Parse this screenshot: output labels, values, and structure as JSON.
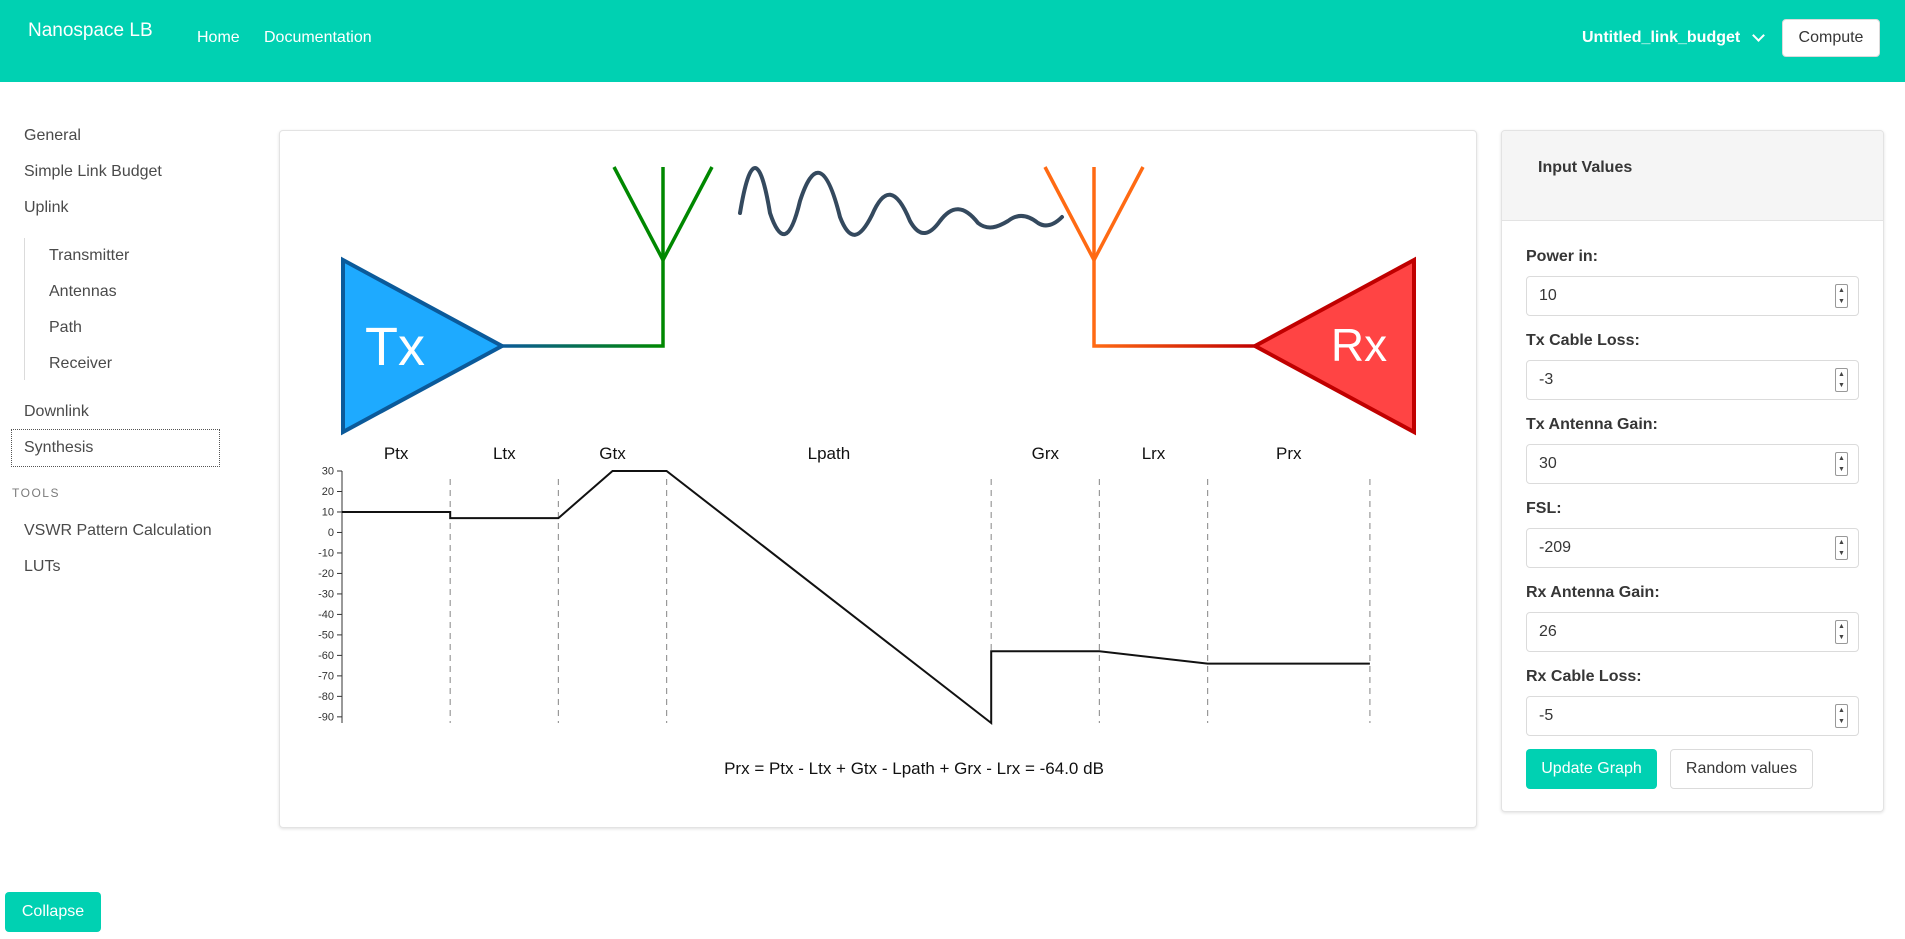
{
  "navbar": {
    "brand": "Nanospace LB",
    "links": [
      "Home",
      "Documentation"
    ],
    "project_name": "Untitled_link_budget",
    "compute_label": "Compute",
    "color": "#00d1b2"
  },
  "sidebar": {
    "items": [
      "General",
      "Simple Link Budget",
      "Uplink"
    ],
    "uplink_items": [
      "Transmitter",
      "Antennas",
      "Path",
      "Receiver"
    ],
    "after_items": [
      "Downlink",
      "Synthesis"
    ],
    "active_item": "Synthesis",
    "tools_label": "TOOLS",
    "tools": [
      "VSWR Pattern Calculation",
      "LUTs"
    ],
    "collapse_label": "Collapse"
  },
  "diagram": {
    "tx_label": "Tx",
    "rx_label": "Rx",
    "tx_color": "#1eaaff",
    "rx_color": "#ff4444",
    "tx_antenna_color": "#008800",
    "rx_antenna_color": "#ff6a13"
  },
  "chart_data": {
    "type": "line",
    "categories": [
      "Ptx",
      "Ltx",
      "Gtx",
      "Lpath",
      "Grx",
      "Lrx",
      "Prx"
    ],
    "y_ticks": [
      30,
      20,
      10,
      0,
      -10,
      -20,
      -30,
      -40,
      -50,
      -60,
      -70,
      -80,
      -90
    ],
    "ylim": [
      -93,
      30
    ],
    "x": [
      0,
      1,
      1,
      2,
      2.5,
      3,
      6,
      6,
      7,
      8,
      9.5
    ],
    "values": [
      10,
      10,
      7,
      7,
      30,
      30,
      -93,
      -58,
      -58,
      -64,
      -64
    ],
    "dividers": [
      1,
      2,
      3,
      6,
      7,
      8,
      9.5
    ],
    "grid": false,
    "formula": "Prx = Ptx - Ltx + Gtx - Lpath + Grx - Lrx = -64.0 dB"
  },
  "inputs": {
    "title": "Input Values",
    "fields": [
      {
        "label": "Power in:",
        "value": "10"
      },
      {
        "label": "Tx Cable Loss:",
        "value": "-3"
      },
      {
        "label": "Tx Antenna Gain:",
        "value": "30"
      },
      {
        "label": "FSL:",
        "value": "-209"
      },
      {
        "label": "Rx Antenna Gain:",
        "value": "26"
      },
      {
        "label": "Rx Cable Loss:",
        "value": "-5"
      }
    ],
    "update_label": "Update Graph",
    "random_label": "Random values"
  }
}
